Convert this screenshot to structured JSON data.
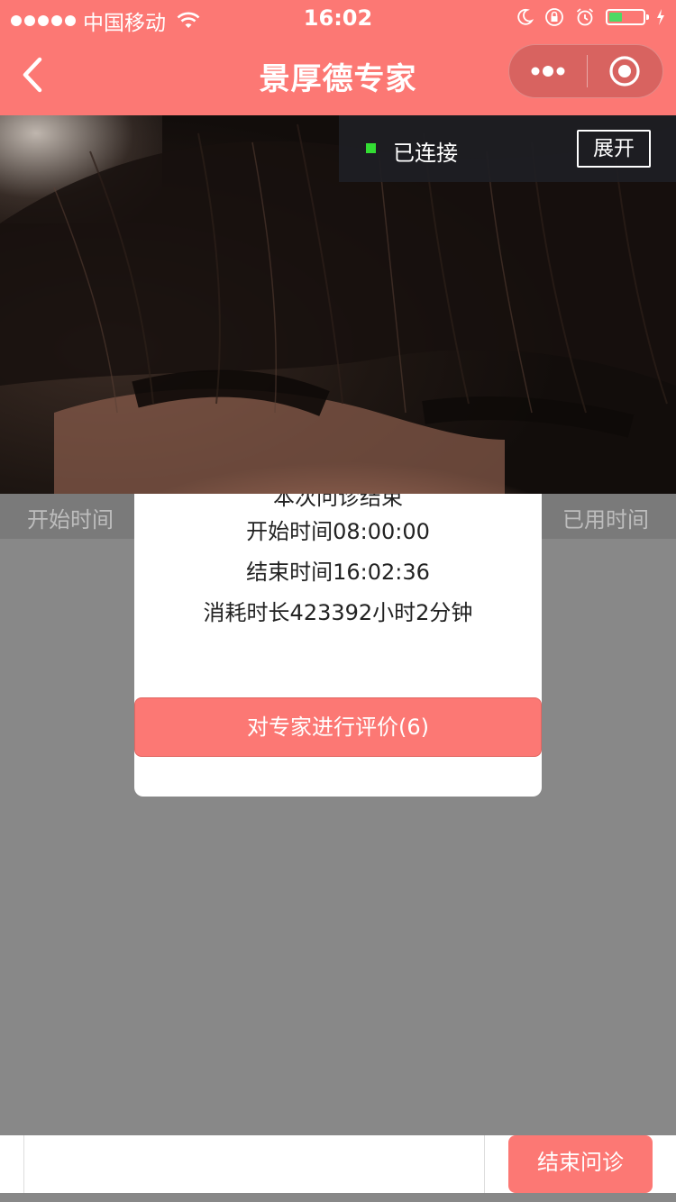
{
  "status_bar": {
    "carrier": "中国移动",
    "time": "16:02",
    "battery_level": 0.4
  },
  "nav": {
    "title": "景厚德专家"
  },
  "connection": {
    "status": "已连接",
    "expand_label": "展开"
  },
  "time_header": {
    "left": "开始时间",
    "right": "已用时间"
  },
  "modal": {
    "clipped_title": "本次问诊结束",
    "start_time": "开始时间08:00:00",
    "end_time": "结束时间16:02:36",
    "duration": "消耗时长423392小时2分钟",
    "rate_button": "对专家进行评价(6)"
  },
  "bottom": {
    "input_value": "",
    "end_button": "结束问诊"
  },
  "colors": {
    "brand": "#fc7874",
    "overlay_gray": "#888888",
    "connected_green": "#33dd33"
  }
}
